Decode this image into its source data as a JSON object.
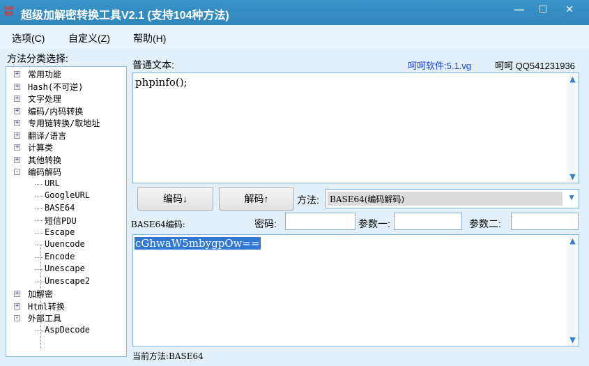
{
  "window": {
    "title": "超级加解密转换工具V2.1 (支持104种方法)",
    "logo_text": "5i68 软件",
    "minimize": "—",
    "maximize": "☐",
    "close": "✕"
  },
  "menu": {
    "items": [
      "选项(C)",
      "自定义(Z)",
      "帮助(H)"
    ]
  },
  "sidebar": {
    "label": "方法分类选择:",
    "tree": [
      {
        "label": "常用功能",
        "state": "+"
      },
      {
        "label": "Hash(不可逆)",
        "state": "+"
      },
      {
        "label": "文字处理",
        "state": "+"
      },
      {
        "label": "编码/内码转换",
        "state": "+"
      },
      {
        "label": "专用链转换/取地址",
        "state": "+"
      },
      {
        "label": "翻译/语言",
        "state": "+"
      },
      {
        "label": "计算类",
        "state": "+"
      },
      {
        "label": "其他转换",
        "state": "+"
      },
      {
        "label": "编码解码",
        "state": "-"
      },
      {
        "label": "URL",
        "leaf": true
      },
      {
        "label": "GoogleURL",
        "leaf": true
      },
      {
        "label": "BASE64",
        "leaf": true
      },
      {
        "label": "短信PDU",
        "leaf": true
      },
      {
        "label": "Escape",
        "leaf": true
      },
      {
        "label": "Uuencode",
        "leaf": true
      },
      {
        "label": "Encode",
        "leaf": true
      },
      {
        "label": "Unescape",
        "leaf": true
      },
      {
        "label": "Unescape2",
        "leaf": true
      },
      {
        "label": "加解密",
        "state": "+"
      },
      {
        "label": "Html转换",
        "state": "+"
      },
      {
        "label": "外部工具",
        "state": "-"
      },
      {
        "label": "AspDecode",
        "leaf": true
      }
    ]
  },
  "main": {
    "input_label": "普通文本:",
    "brand": "呵呵软件:5.1.vg",
    "author": "呵呵 QQ541231936",
    "input_text": "phpinfo();",
    "encode_button": "编码↓",
    "decode_button": "解码↑",
    "method_label": "方法:",
    "method_value": "BASE64(编码解码)",
    "output_label": "BASE64编码:",
    "password_label": "密码:",
    "param1_label": "参数一:",
    "param2_label": "参数二:",
    "output_text": "cGhwaW5mbygpOw==",
    "status": "当前方法:BASE64",
    "brand_color": "#1a3fe0"
  }
}
